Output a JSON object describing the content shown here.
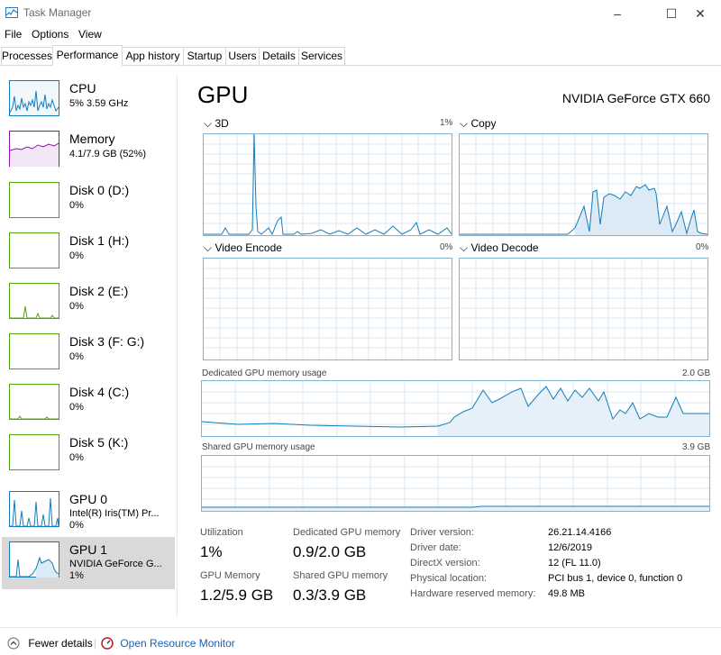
{
  "window": {
    "title": "Task Manager",
    "minimize_glyph": "–",
    "maximize_glyph": "☐",
    "close_glyph": "✕"
  },
  "menu": [
    "File",
    "Options",
    "View"
  ],
  "tabs": [
    "Processes",
    "Performance",
    "App history",
    "Startup",
    "Users",
    "Details",
    "Services"
  ],
  "sidebar": [
    {
      "label": "CPU",
      "sub1": "5%  3.59 GHz",
      "sub2": "",
      "color": "#117dbb"
    },
    {
      "label": "Memory",
      "sub1": "4.1/7.9 GB (52%)",
      "sub2": "",
      "color": "#8b12ae"
    },
    {
      "label": "Disk 0 (D:)",
      "sub1": "0%",
      "sub2": "",
      "color": "#4da60c"
    },
    {
      "label": "Disk 1 (H:)",
      "sub1": "0%",
      "sub2": "",
      "color": "#4da60c"
    },
    {
      "label": "Disk 2 (E:)",
      "sub1": "0%",
      "sub2": "",
      "color": "#4da60c"
    },
    {
      "label": "Disk 3 (F: G:)",
      "sub1": "0%",
      "sub2": "",
      "color": "#4da60c"
    },
    {
      "label": "Disk 4 (C:)",
      "sub1": "0%",
      "sub2": "",
      "color": "#4da60c"
    },
    {
      "label": "Disk 5 (K:)",
      "sub1": "0%",
      "sub2": "",
      "color": "#4da60c"
    },
    {
      "label": "GPU 0",
      "sub1": "Intel(R) Iris(TM) Pr...",
      "sub2": "0%",
      "color": "#117dbb"
    },
    {
      "label": "GPU 1",
      "sub1": "NVIDIA GeForce G...",
      "sub2": "1%",
      "color": "#117dbb"
    }
  ],
  "main": {
    "title": "GPU",
    "gpu_name": "NVIDIA GeForce GTX 660",
    "engines": [
      {
        "name": "3D",
        "percent": "1%"
      },
      {
        "name": "Copy",
        "percent": ""
      },
      {
        "name": "Video Encode",
        "percent": "0%"
      },
      {
        "name": "Video Decode",
        "percent": "0%"
      }
    ],
    "dedicated_label": "Dedicated GPU memory usage",
    "dedicated_max": "2.0 GB",
    "shared_label": "Shared GPU memory usage",
    "shared_max": "3.9 GB",
    "stats": {
      "utilization_label": "Utilization",
      "utilization": "1%",
      "dedicated_label": "Dedicated GPU memory",
      "dedicated": "0.9/2.0 GB",
      "gpu_memory_label": "GPU Memory",
      "gpu_memory": "1.2/5.9 GB",
      "shared_label": "Shared GPU memory",
      "shared": "0.3/3.9 GB"
    },
    "info": [
      {
        "label": "Driver version:",
        "value": "26.21.14.4166"
      },
      {
        "label": "Driver date:",
        "value": "12/6/2019"
      },
      {
        "label": "DirectX version:",
        "value": "12 (FL 11.0)"
      },
      {
        "label": "Physical location:",
        "value": "PCI bus 1, device 0, function 0"
      },
      {
        "label": "Hardware reserved memory:",
        "value": "49.8 MB"
      }
    ]
  },
  "footer": {
    "fewer_details": "Fewer details",
    "resource_monitor": "Open Resource Monitor"
  }
}
